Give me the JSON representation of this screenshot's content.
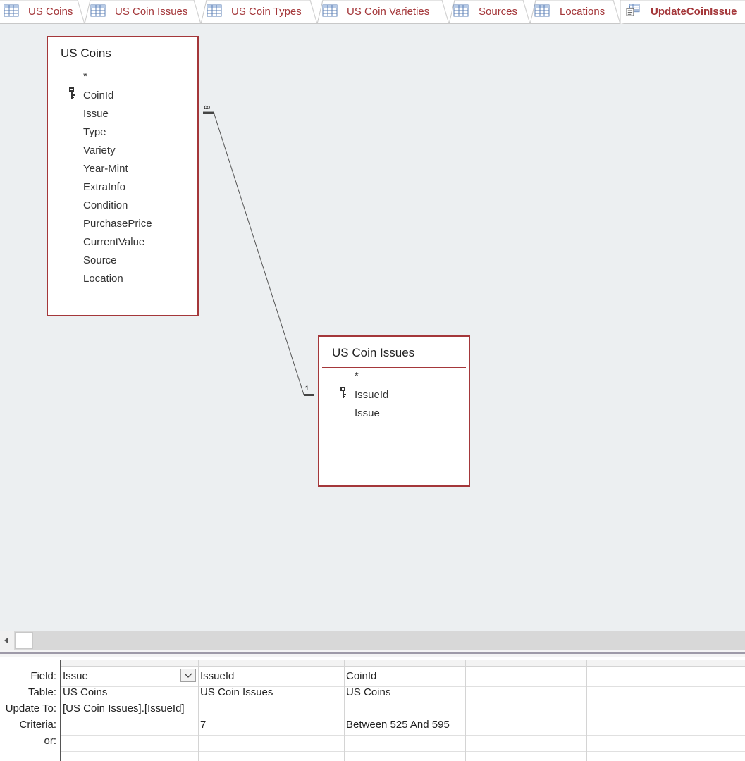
{
  "tabs": [
    {
      "label": "US Coins",
      "type": "table"
    },
    {
      "label": "US Coin Issues",
      "type": "table"
    },
    {
      "label": "US Coin Types",
      "type": "table"
    },
    {
      "label": "US Coin Varieties",
      "type": "table"
    },
    {
      "label": "Sources",
      "type": "table"
    },
    {
      "label": "Locations",
      "type": "table"
    },
    {
      "label": "UpdateCoinIssue",
      "type": "query",
      "active": true
    }
  ],
  "tables": {
    "us_coins": {
      "title": "US Coins",
      "fields": [
        "*",
        "CoinId",
        "Issue",
        "Type",
        "Variety",
        "Year-Mint",
        "ExtraInfo",
        "Condition",
        "PurchasePrice",
        "CurrentValue",
        "Source",
        "Location"
      ],
      "primary_key": "CoinId"
    },
    "us_coin_issues": {
      "title": "US Coin Issues",
      "fields": [
        "*",
        "IssueId",
        "Issue"
      ],
      "primary_key": "IssueId"
    }
  },
  "relationship": {
    "many_symbol": "∞",
    "one_symbol": "1"
  },
  "grid": {
    "row_labels": [
      "Field:",
      "Table:",
      "Update To:",
      "Criteria:",
      "or:"
    ],
    "columns": [
      {
        "field": "Issue",
        "table": "US Coins",
        "update_to": "[US Coin Issues].[IssueId]",
        "criteria": "",
        "or": ""
      },
      {
        "field": "IssueId",
        "table": "US Coin Issues",
        "update_to": "",
        "criteria": "7",
        "or": ""
      },
      {
        "field": "CoinId",
        "table": "US Coins",
        "update_to": "",
        "criteria": "Between 525 And 595",
        "or": ""
      },
      {
        "field": "",
        "table": "",
        "update_to": "",
        "criteria": "",
        "or": ""
      },
      {
        "field": "",
        "table": "",
        "update_to": "",
        "criteria": "",
        "or": ""
      },
      {
        "field": "",
        "table": "",
        "update_to": "",
        "criteria": "",
        "or": ""
      }
    ]
  },
  "colors": {
    "accent": "#a4373a",
    "surface": "#eceff1"
  }
}
